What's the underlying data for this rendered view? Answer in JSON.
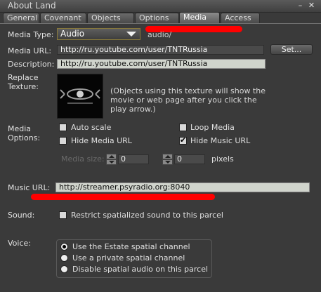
{
  "window": {
    "title": "About Land",
    "minimize_icon": "minimize-icon",
    "close_icon": "close-icon"
  },
  "tabs": [
    {
      "label": "General"
    },
    {
      "label": "Covenant"
    },
    {
      "label": "Objects"
    },
    {
      "label": "Options"
    },
    {
      "label": "Media",
      "active": true
    },
    {
      "label": "Access"
    }
  ],
  "media": {
    "type_label": "Media Type:",
    "type_value": "Audio",
    "mime_text": "audio/",
    "url_label": "Media URL:",
    "url_value": "http://ru.youtube.com/user/TNTRussia",
    "set_button": "Set...",
    "description_label": "Description:",
    "description_value": "http://ru.youtube.com/user/TNTRussia",
    "replace_label_1": "Replace",
    "replace_label_2": "Texture:",
    "texture_note": "(Objects using this texture will show the movie or web page after you click the play arrow.)",
    "options_label_1": "Media",
    "options_label_2": "Options:",
    "auto_scale": {
      "label": "Auto scale",
      "checked": false
    },
    "loop_media": {
      "label": "Loop Media",
      "checked": false
    },
    "hide_media_url": {
      "label": "Hide Media URL",
      "checked": false
    },
    "hide_music_url": {
      "label": "Hide Music URL",
      "checked": true
    },
    "media_size_label": "Media size:",
    "width_value": "0",
    "height_value": "0",
    "pixels_label": "pixels"
  },
  "music": {
    "label": "Music URL:",
    "value": "http://streamer.psyradio.org:8040"
  },
  "sound": {
    "label": "Sound:",
    "restrict_label": "Restrict spatialized sound to this parcel",
    "checked": false
  },
  "voice": {
    "label": "Voice:",
    "options": [
      {
        "label": "Use the Estate spatial channel",
        "selected": true
      },
      {
        "label": "Use a private spatial channel",
        "selected": false
      },
      {
        "label": "Disable spatial audio on this parcel",
        "selected": false
      }
    ]
  },
  "colors": {
    "annotation": "#ff0000",
    "background": "#3a3a3a"
  }
}
